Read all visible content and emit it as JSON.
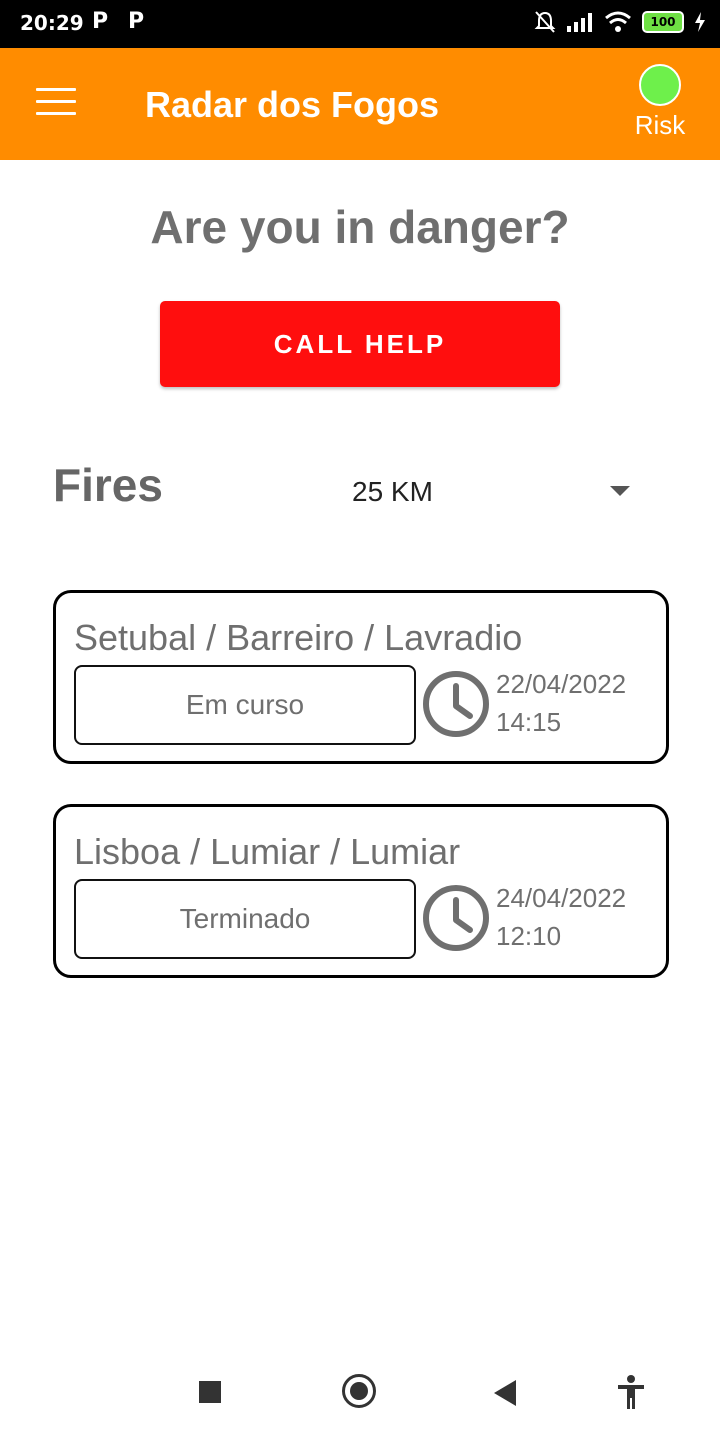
{
  "status_bar": {
    "time": "20:29",
    "notification_icons": [
      "P",
      "P"
    ],
    "battery": "100"
  },
  "app_bar": {
    "title": "Radar dos Fogos",
    "risk_label": "Risk",
    "risk_color": "#6ef04b"
  },
  "main": {
    "danger_question": "Are you in danger?",
    "call_help_label": "CALL HELP",
    "fires_label": "Fires",
    "radius_selected": "25 KM"
  },
  "fires": [
    {
      "location": "Setubal / Barreiro / Lavradio",
      "status": "Em curso",
      "date": "22/04/2022",
      "time": "14:15"
    },
    {
      "location": "Lisboa / Lumiar / Lumiar",
      "status": "Terminado",
      "date": "24/04/2022",
      "time": "12:10"
    }
  ],
  "colors": {
    "app_bar": "#ff8c00",
    "call_help": "#ff0e0e",
    "text_gray": "#6f6f6f"
  }
}
